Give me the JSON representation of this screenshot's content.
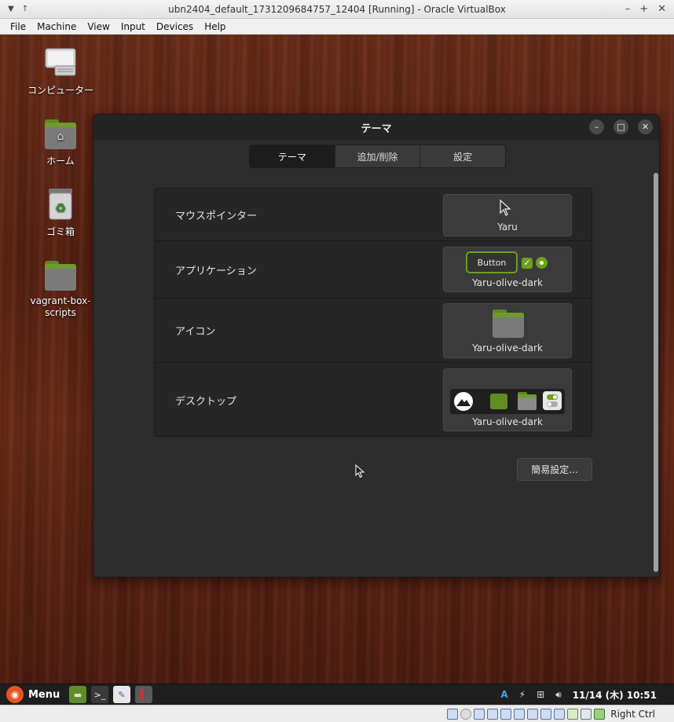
{
  "host": {
    "title": "ubn2404_default_1731209684757_12404 [Running] - Oracle VirtualBox",
    "menu": [
      "File",
      "Machine",
      "View",
      "Input",
      "Devices",
      "Help"
    ],
    "status_right": "Right Ctrl"
  },
  "desktop_icons": [
    {
      "label": "コンピューター",
      "icon": "computer-icon"
    },
    {
      "label": "ホーム",
      "icon": "home-folder-icon"
    },
    {
      "label": "ゴミ箱",
      "icon": "trash-icon"
    },
    {
      "label": "vagrant-box-scripts",
      "icon": "folder-icon"
    }
  ],
  "window": {
    "title": "テーマ",
    "tabs": [
      {
        "label": "テーマ",
        "active": true
      },
      {
        "label": "追加/削除",
        "active": false
      },
      {
        "label": "設定",
        "active": false
      }
    ],
    "rows": [
      {
        "label": "マウスポインター",
        "value": "Yaru"
      },
      {
        "label": "アプリケーション",
        "value": "Yaru-olive-dark",
        "button_sample": "Button"
      },
      {
        "label": "アイコン",
        "value": "Yaru-olive-dark"
      },
      {
        "label": "デスクトップ",
        "value": "Yaru-olive-dark"
      }
    ],
    "simple_settings": "簡易設定...",
    "accent": "#6ca01e"
  },
  "taskbar": {
    "menu_label": "Menu",
    "input_indicator": "A",
    "clock": "11/14 (木) 10:51"
  }
}
